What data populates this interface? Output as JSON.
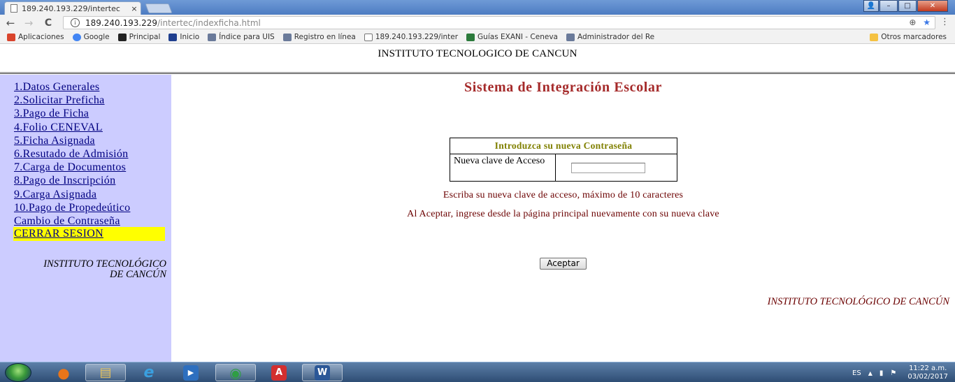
{
  "browser": {
    "tab_title": "189.240.193.229/intertec",
    "tab_close": "×",
    "url_host": "189.240.193.229",
    "url_path": "/intertec/indexficha.html",
    "nav_back": "←",
    "nav_forward": "→",
    "nav_reload": "C",
    "zoom_glyph": "⊕",
    "star_glyph": "★",
    "menu_glyph": "⋮",
    "info_glyph": "i",
    "bookmarks": [
      {
        "label": "Aplicaciones",
        "icon": "apps-grid-icon",
        "color": "#d9442c"
      },
      {
        "label": "Google",
        "icon": "google-icon",
        "color": "#4285f4"
      },
      {
        "label": "Principal",
        "icon": "walmart-icon",
        "color": "#222222"
      },
      {
        "label": "Inicio",
        "icon": "calendar-icon",
        "color": "#1f3f8f"
      },
      {
        "label": "Índice para UIS",
        "icon": "page-icon",
        "color": "#6a7a9a"
      },
      {
        "label": "Registro en línea",
        "icon": "page-icon",
        "color": "#6a7a9a"
      },
      {
        "label": "189.240.193.229/inter",
        "icon": "document-icon",
        "color": "#ffffff"
      },
      {
        "label": "Guías EXANI - Ceneva",
        "icon": "ceneval-icon",
        "color": "#2b7a3b"
      },
      {
        "label": "Administrador del Re",
        "icon": "page-icon",
        "color": "#6a7a9a"
      }
    ],
    "other_bookmarks": "Otros marcadores"
  },
  "header": {
    "institution": "INSTITUTO TECNOLOGICO DE CANCUN"
  },
  "sidebar": {
    "items": [
      {
        "label": "1.Datos Generales"
      },
      {
        "label": "2.Solicitar Preficha"
      },
      {
        "label": "3.Pago de Ficha"
      },
      {
        "label": "4.Folio CENEVAL"
      },
      {
        "label": "5.Ficha Asignada"
      },
      {
        "label": "6.Resutado de Admisión"
      },
      {
        "label": "7.Carga de Documentos"
      },
      {
        "label": "8.Pago de Inscripción"
      },
      {
        "label": "9.Carga Asignada"
      },
      {
        "label": "10.Pago de Propedeútico"
      },
      {
        "label": "Cambio de Contraseña"
      }
    ],
    "logout": "CERRAR SESION",
    "footer_line1": "INSTITUTO TECNOLÓGICO",
    "footer_line2": "DE CANCÚN"
  },
  "main": {
    "title": "Sistema de Integración Escolar",
    "form_header": "Introduzca su nueva Contraseña",
    "field_label": "Nueva clave de Acceso",
    "field_value": "",
    "hint_max": "Escriba su nueva clave de acceso, máximo de 10 caracteres",
    "hint_login": "Al Aceptar, ingrese desde la página principal nuevamente con su nueva clave",
    "accept_button": "Aceptar",
    "footer": "INSTITUTO TECNOLÓGICO DE CANCÚN"
  },
  "taskbar": {
    "apps": [
      {
        "name": "firefox-icon",
        "glyph": "●",
        "color": "#e8751a"
      },
      {
        "name": "explorer-folder-icon",
        "glyph": "▤",
        "color": "#e8c25a"
      },
      {
        "name": "internet-explorer-icon",
        "glyph": "e",
        "color": "#3aa0e0"
      },
      {
        "name": "media-player-icon",
        "glyph": "▶",
        "color": "#2d6fbf"
      },
      {
        "name": "chrome-icon",
        "glyph": "◉",
        "color": "#2f9e44"
      },
      {
        "name": "acrobat-icon",
        "glyph": "A",
        "color": "#d32f2f"
      },
      {
        "name": "word-icon",
        "glyph": "W",
        "color": "#2b5797"
      }
    ],
    "lang": "ES",
    "tray_up": "▲",
    "time": "11:22 a.m.",
    "date": "03/02/2017"
  },
  "colors": {
    "sidebar_bg": "#ccccff",
    "logout_highlight": "#ffff00",
    "title_red": "#a52a2a",
    "form_header_olive": "#808000",
    "link_blue": "#000080"
  }
}
